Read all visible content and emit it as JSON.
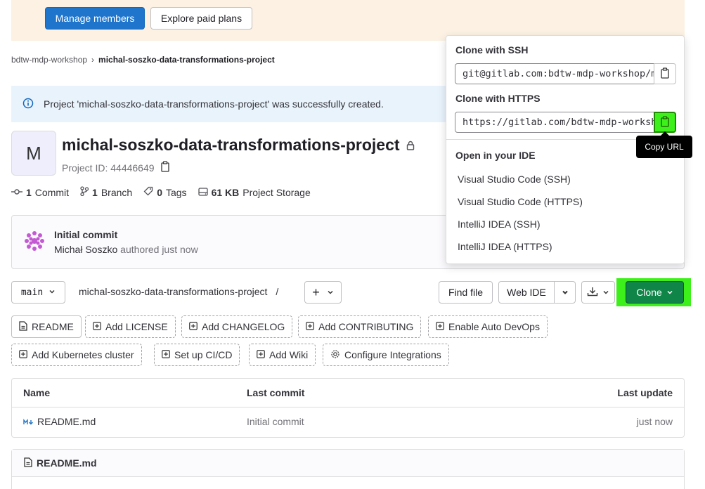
{
  "banner": {
    "manage_members": "Manage members",
    "explore_plans": "Explore paid plans"
  },
  "breadcrumb": {
    "group": "bdtw-mdp-workshop",
    "separator": "›",
    "project": "michal-soszko-data-transformations-project"
  },
  "alert": {
    "message": "Project 'michal-soszko-data-transformations-project' was successfully created."
  },
  "project": {
    "avatar_letter": "M",
    "title": "michal-soszko-data-transformations-project",
    "id_text": "Project ID: 44446649"
  },
  "stats": {
    "commits_count": "1",
    "commits_label": "Commit",
    "branches_count": "1",
    "branches_label": "Branch",
    "tags_count": "0",
    "tags_label": "Tags",
    "storage_size": "61 KB",
    "storage_label": "Project Storage"
  },
  "last_commit": {
    "title": "Initial commit",
    "author": "Michał Soszko",
    "suffix": "authored just now"
  },
  "toolbar": {
    "branch": "main",
    "path": "michal-soszko-data-transformations-project",
    "path_sep": "/",
    "plus": "+",
    "find_file": "Find file",
    "web_ide": "Web IDE",
    "clone": "Clone"
  },
  "shortcuts": {
    "readme": "README",
    "add_license": "Add LICENSE",
    "add_changelog": "Add CHANGELOG",
    "add_contributing": "Add CONTRIBUTING",
    "auto_devops": "Enable Auto DevOps",
    "k8s": "Add Kubernetes cluster",
    "cicd": "Set up CI/CD",
    "wiki": "Add Wiki",
    "integrations": "Configure Integrations"
  },
  "table": {
    "headers": {
      "name": "Name",
      "last_commit": "Last commit",
      "last_update": "Last update"
    },
    "rows": [
      {
        "name": "README.md",
        "commit": "Initial commit",
        "updated": "just now"
      }
    ]
  },
  "readme_panel": {
    "title": "README.md"
  },
  "clone_dropdown": {
    "ssh_label": "Clone with SSH",
    "ssh_url": "git@gitlab.com:bdtw-mdp-workshop/michal-soszko-data-transformations-project.git",
    "https_label": "Clone with HTTPS",
    "https_url": "https://gitlab.com/bdtw-mdp-workshop/michal-soszko-data-transformations-project.git",
    "ide_label": "Open in your IDE",
    "ide_items": [
      "Visual Studio Code (SSH)",
      "Visual Studio Code (HTTPS)",
      "IntelliJ IDEA (SSH)",
      "IntelliJ IDEA (HTTPS)"
    ],
    "tooltip": "Copy URL"
  },
  "colors": {
    "primary": "#1f75cb",
    "confirm": "#108548",
    "highlight": "#3ef01b",
    "banner": "#fcf1e3",
    "info_bg": "#e9f3fc"
  }
}
